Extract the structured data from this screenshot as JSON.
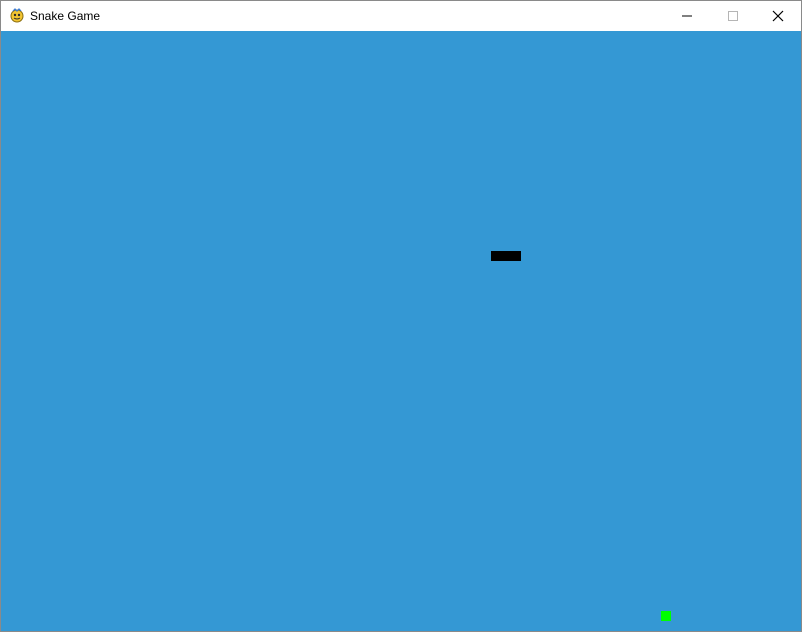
{
  "window": {
    "title": "Snake Game",
    "icon": "pygame-snake-icon"
  },
  "titlebar_controls": {
    "minimize": "minimize-icon",
    "maximize": "maximize-icon",
    "close": "close-icon"
  },
  "game": {
    "background_color": "#3498d4",
    "snake_color": "#000000",
    "food_color": "#00ff00",
    "cell_size": 10,
    "snake": [
      {
        "col": 49,
        "row": 22
      },
      {
        "col": 50,
        "row": 22
      },
      {
        "col": 51,
        "row": 22
      }
    ],
    "food": {
      "col": 66,
      "row": 58
    }
  }
}
